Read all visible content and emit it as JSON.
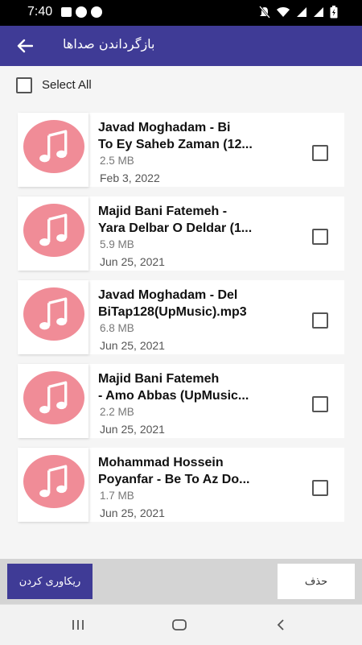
{
  "status_bar": {
    "time": "7:40"
  },
  "app_bar": {
    "title": "بازگرداندن صداها",
    "back_icon": "arrow-left-icon"
  },
  "select_all": {
    "label": "Select All",
    "checked": false
  },
  "items": [
    {
      "title_line1": "Javad Moghadam - Bi",
      "title_line2": "To Ey Saheb Zaman (12...",
      "size": "2.5 MB",
      "date": "Feb 3, 2022",
      "checked": false
    },
    {
      "title_line1": "Majid Bani Fatemeh -",
      "title_line2": "Yara Delbar O Deldar (1...",
      "size": "5.9 MB",
      "date": "Jun 25, 2021",
      "checked": false
    },
    {
      "title_line1": "Javad Moghadam - Del",
      "title_line2": "BiTap128(UpMusic).mp3",
      "size": "6.8 MB",
      "date": "Jun 25, 2021",
      "checked": false
    },
    {
      "title_line1": "Majid Bani Fatemeh",
      "title_line2": "- Amo Abbas (UpMusic...",
      "size": "2.2 MB",
      "date": "Jun 25, 2021",
      "checked": false
    },
    {
      "title_line1": "Mohammad Hossein",
      "title_line2": "Poyanfar - Be To Az Do...",
      "size": "1.7 MB",
      "date": "Jun 25, 2021",
      "checked": false
    }
  ],
  "actions": {
    "recover_label": "ریکاوری کردن",
    "delete_label": "حذف"
  },
  "colors": {
    "primary": "#3f3b96",
    "music_icon_bg": "#f08c97"
  }
}
